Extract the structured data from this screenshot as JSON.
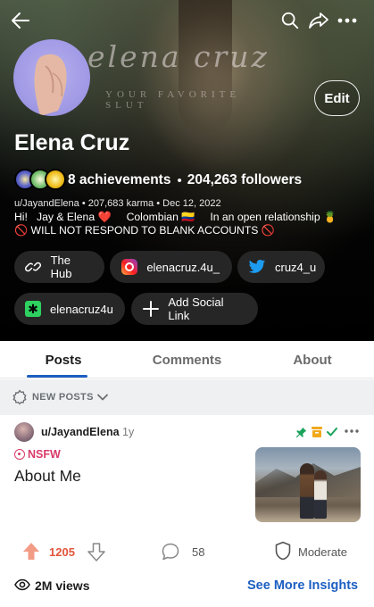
{
  "banner": {
    "watermark_title": "elena cruz",
    "watermark_subtitle": "YOUR FAVORITE SLUT"
  },
  "header": {
    "back_icon": "arrow-left-icon",
    "search_icon": "search-icon",
    "share_icon": "share-arrow-icon",
    "more_icon": "more-horizontal-icon",
    "edit_label": "Edit"
  },
  "profile": {
    "name": "Elena Cruz",
    "achievements": "8 achievements",
    "followers": "204,263 followers",
    "username": "u/JayandElena",
    "karma": "207,683 karma",
    "cake_day": "Dec 12, 2022",
    "bio_line1": "Hi!   Jay & Elena ❤️     Colombian 🇨🇴     In an open relationship 🍍",
    "bio_line2": "🚫 WILL NOT RESPOND TO BLANK ACCOUNTS 🚫"
  },
  "social_links": [
    {
      "label": "The Hub",
      "icon": "link-icon"
    },
    {
      "label": "elenacruz.4u_",
      "icon": "instagram-icon"
    },
    {
      "label": "cruz4_u",
      "icon": "twitter-icon"
    },
    {
      "label": "elenacruz4u",
      "icon": "custom-link-icon"
    },
    {
      "label": "Add Social Link",
      "icon": "plus-icon"
    }
  ],
  "tabs": [
    {
      "label": "Posts",
      "active": true
    },
    {
      "label": "Comments",
      "active": false
    },
    {
      "label": "About",
      "active": false
    }
  ],
  "sort": {
    "label": "NEW POSTS"
  },
  "post": {
    "user": "u/JayandElena",
    "age": "1y",
    "tag": "NSFW",
    "title": "About Me",
    "votes": "1205",
    "comments": "58",
    "moderate_label": "Moderate",
    "views": "2M views",
    "insights_label": "See More Insights"
  },
  "colors": {
    "accent_blue": "#1c5fc2",
    "upvote": "#e0553a",
    "nsfw": "#d93a6a"
  }
}
